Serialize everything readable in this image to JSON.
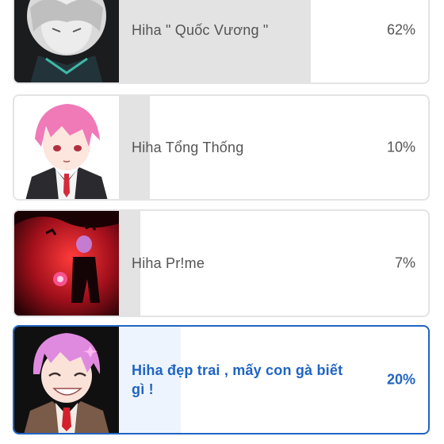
{
  "poll": {
    "options": [
      {
        "label": "Hiha \" Quốc Vương \"",
        "percent_text": "62%",
        "percent": 62,
        "selected": false,
        "thumbnail_icon": "anime-avatar-white-hair-icon"
      },
      {
        "label": "Hiha Tổng Thống",
        "percent_text": "10%",
        "percent": 10,
        "selected": false,
        "thumbnail_icon": "anime-avatar-pink-hair-suit-icon"
      },
      {
        "label": "Hiha Pr!me",
        "percent_text": "7%",
        "percent": 7,
        "selected": false,
        "thumbnail_icon": "anime-avatar-dark-red-scene-icon"
      },
      {
        "label": "Hiha đẹp trai , mấy con gà biết gì !",
        "percent_text": "20%",
        "percent": 20,
        "selected": true,
        "thumbnail_icon": "anime-avatar-pink-hair-smiling-icon"
      }
    ]
  },
  "colors": {
    "selected_accent": "#1f64c4",
    "bar_fill": "#e3e3e3",
    "selected_bar_fill": "#eef4fd",
    "border": "#e4e4e6",
    "text": "#545454"
  }
}
